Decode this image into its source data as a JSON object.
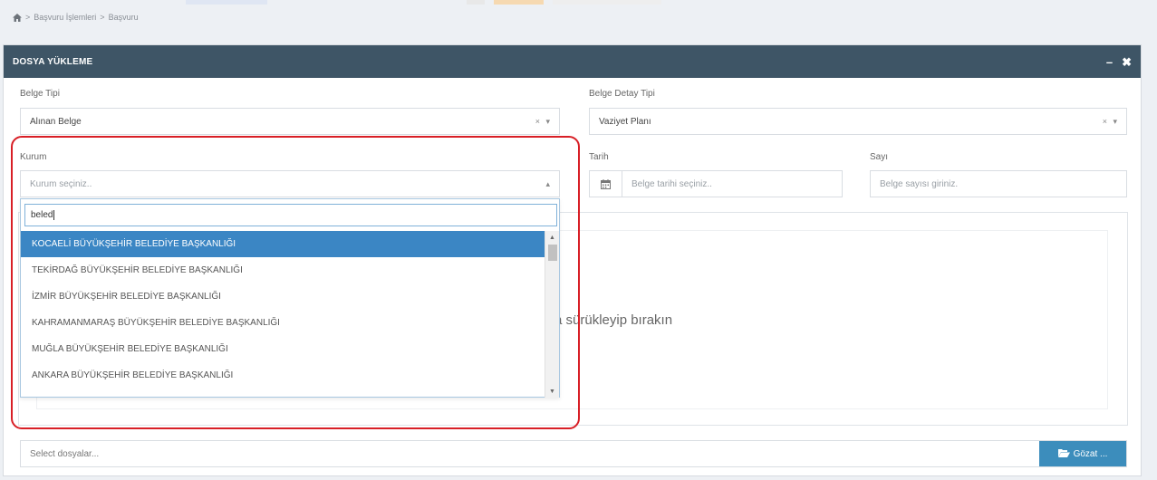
{
  "breadcrumb": {
    "item1": "Başvuru İşlemleri",
    "item2": "Başvuru",
    "separator": ">"
  },
  "panel": {
    "title": "DOSYA YÜKLEME",
    "minimize": "–",
    "close": "✖"
  },
  "form": {
    "belge_tipi": {
      "label": "Belge Tipi",
      "value": "Alınan Belge"
    },
    "belge_detay_tipi": {
      "label": "Belge Detay Tipi",
      "value": "Vaziyet Planı"
    },
    "kurum": {
      "label": "Kurum",
      "placeholder": "Kurum seçiniz.."
    },
    "tarih": {
      "label": "Tarih",
      "placeholder": "Belge tarihi seçiniz.."
    },
    "sayi": {
      "label": "Sayı",
      "placeholder": "Belge sayısı giriniz."
    },
    "clear_arrows": "× ▾",
    "open_arrow": "▴"
  },
  "dropdown": {
    "search_value": "beled",
    "items": [
      "KOCAELİ BÜYÜKŞEHİR BELEDİYE BAŞKANLIĞI",
      "TEKİRDAĞ BÜYÜKŞEHİR BELEDİYE BAŞKANLIĞI",
      "İZMİR BÜYÜKŞEHİR BELEDİYE BAŞKANLIĞI",
      "KAHRAMANMARAŞ BÜYÜKŞEHİR BELEDİYE BAŞKANLIĞI",
      "MUĞLA BÜYÜKŞEHİR BELEDİYE BAŞKANLIĞI",
      "ANKARA BÜYÜKŞEHİR BELEDİYE BAŞKANLIĞI"
    ],
    "selected_index": 0
  },
  "dropzone": {
    "text": "a sürükleyip bırakın"
  },
  "file": {
    "placeholder": "Select dosyalar...",
    "browse_label": "Gözat ..."
  },
  "colors": {
    "header": "#3e5566",
    "accent": "#3b86c4",
    "highlight": "#d81f26"
  },
  "icons": [
    "home-icon",
    "calendar-icon",
    "folder-open-icon"
  ]
}
